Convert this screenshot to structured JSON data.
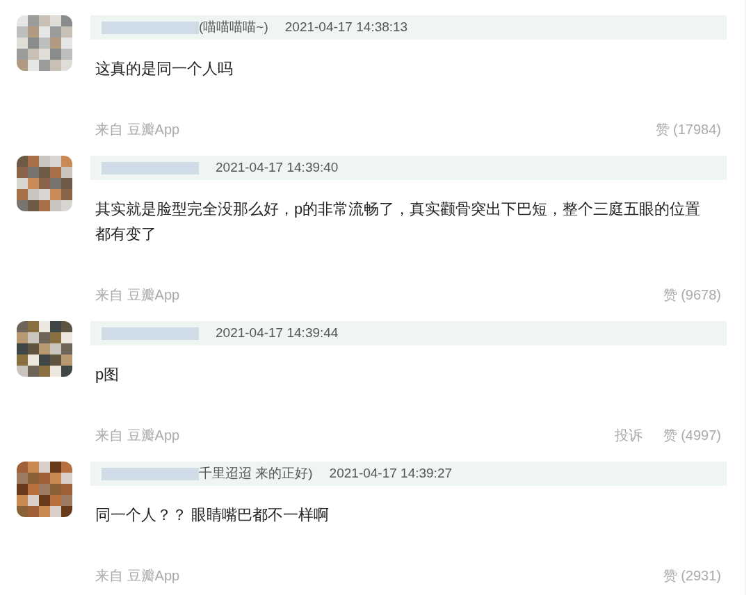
{
  "comments": [
    {
      "name_tail": "(喵喵喵喵~)",
      "time": "2021-04-17 14:38:13",
      "text": "这真的是同一个人吗",
      "source": "来自 豆瓣App",
      "likes": "赞 (17984)"
    },
    {
      "time": "2021-04-17 14:39:40",
      "text": "其实就是脸型完全没那么好，p的非常流畅了，真实颧骨突出下巴短，整个三庭五眼的位置都有变了",
      "source": "来自 豆瓣App",
      "likes": "赞 (9678)"
    },
    {
      "time": "2021-04-17 14:39:44",
      "text": "p图",
      "source": "来自 豆瓣App",
      "report": "投诉",
      "likes": "赞 (4997)"
    },
    {
      "name_tail": "千里迢迢 来的正好)",
      "time": "2021-04-17 14:39:27",
      "text": "同一个人？？ 眼睛嘴巴都不一样啊",
      "source": "来自 豆瓣App",
      "likes": "赞 (2931)"
    }
  ]
}
